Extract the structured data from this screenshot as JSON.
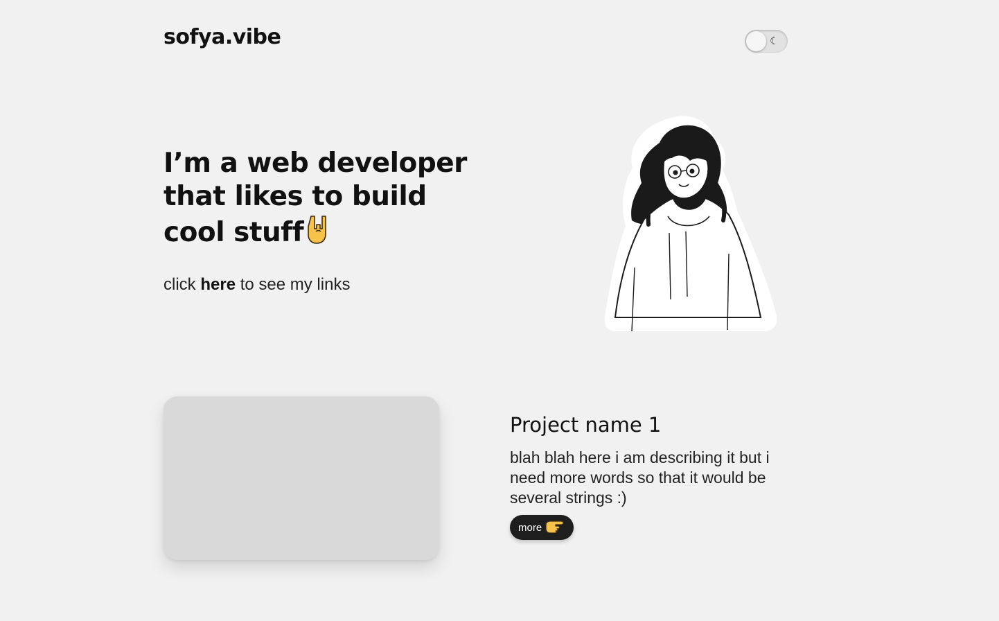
{
  "header": {
    "logo": "sofya.vibe",
    "theme_toggle_icon": "☾"
  },
  "hero": {
    "title": "I’m a web developer that likes to build cool stuff",
    "emoji": "🤘",
    "links_prefix": "click",
    "links_link": "here",
    "links_suffix": "to see my links"
  },
  "project": {
    "title": "Project name 1",
    "description": "blah blah here i am describing it but i need more words so that it would be several strings :)",
    "button_label": "more",
    "button_emoji": "👉"
  },
  "colors": {
    "background": "#f1f1f1",
    "text": "#111111",
    "button": "#1e1e1e",
    "image_placeholder": "#d9d9d9"
  }
}
